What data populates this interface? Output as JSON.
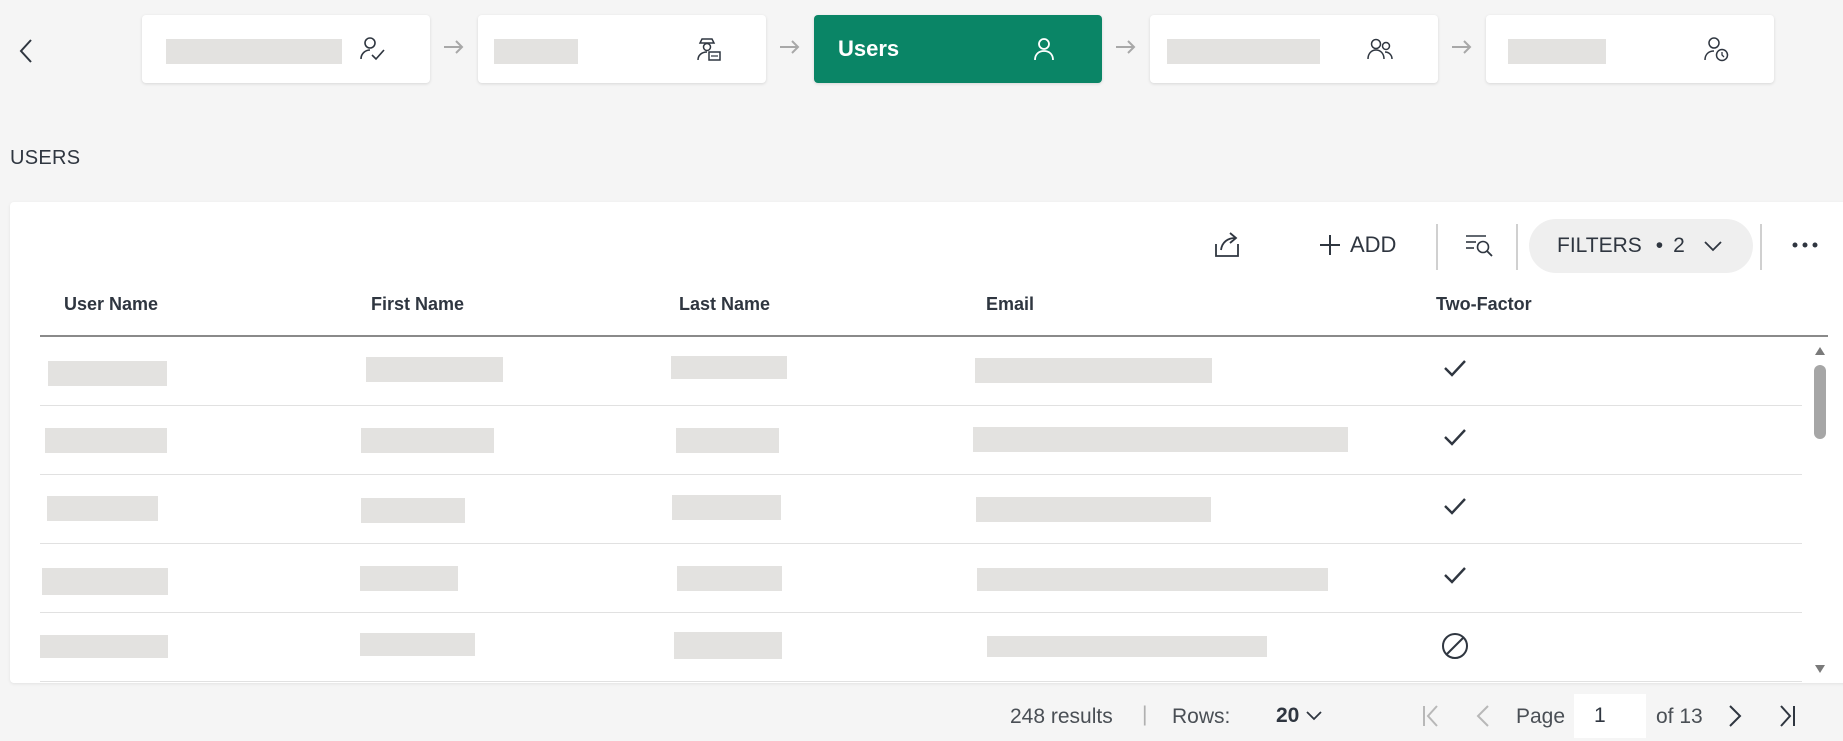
{
  "stepper": {
    "steps": [
      {
        "label": "",
        "icon": "user-check-icon",
        "state": "inactive"
      },
      {
        "label": "",
        "icon": "user-badge-icon",
        "state": "inactive"
      },
      {
        "label": "Users",
        "icon": "user-icon",
        "state": "active"
      },
      {
        "label": "",
        "icon": "users-group-icon",
        "state": "inactive"
      },
      {
        "label": "",
        "icon": "user-clock-icon",
        "state": "inactive"
      }
    ]
  },
  "section": {
    "title": "USERS"
  },
  "toolbar": {
    "add_label": "ADD",
    "filters_label": "FILTERS",
    "filters_count": "2",
    "filters_separator": "•"
  },
  "table": {
    "columns": [
      "User Name",
      "First Name",
      "Last Name",
      "Email",
      "Two-Factor"
    ],
    "rows": [
      {
        "two_factor": "enabled"
      },
      {
        "two_factor": "enabled"
      },
      {
        "two_factor": "enabled"
      },
      {
        "two_factor": "enabled"
      },
      {
        "two_factor": "disabled"
      }
    ]
  },
  "footer": {
    "results": "248 results",
    "separator": "|",
    "rows_label": "Rows:",
    "rows_value": "20",
    "page_label": "Page",
    "page_value": "1",
    "page_total": "of 13"
  },
  "colors": {
    "accent": "#0a8566",
    "placeholder": "#e3e2e0",
    "text": "#2f3640"
  }
}
